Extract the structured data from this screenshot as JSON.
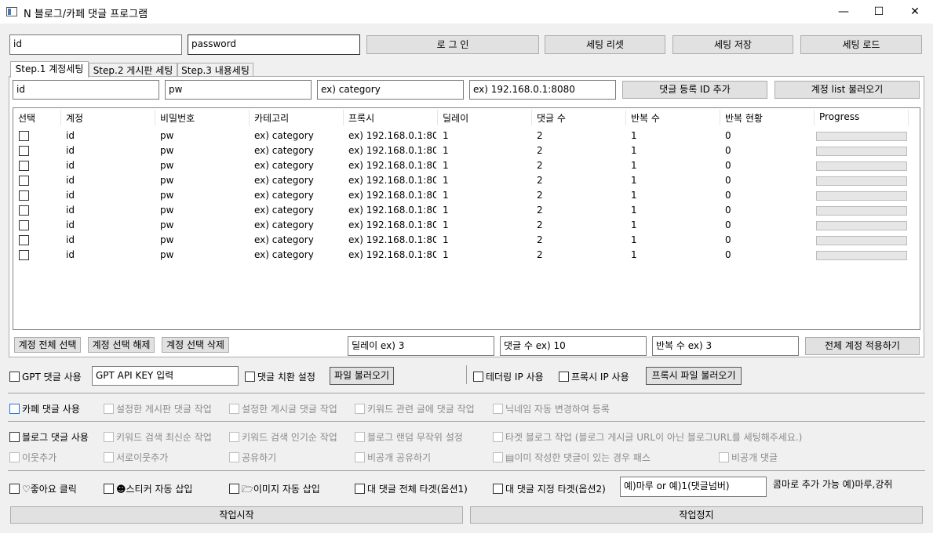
{
  "window": {
    "title": "N 블로그/카페 댓글 프로그램",
    "min": "—",
    "max": "☐",
    "close": "✕"
  },
  "login": {
    "id_value": "id",
    "password_value": "password",
    "login_label": "로 그 인",
    "reset_label": "세팅 리셋",
    "save_label": "세팅 저장",
    "load_label": "세팅 로드"
  },
  "tabs": [
    {
      "label": "Step.1 계정세팅"
    },
    {
      "label": "Step.2 게시판 세팅"
    },
    {
      "label": "Step.3 내용세팅"
    }
  ],
  "account_form": {
    "id": "id",
    "pw": "pw",
    "category": "ex) category",
    "proxy": "ex) 192.168.0.1:8080",
    "add_label": "댓글 등록 ID 추가",
    "load_list_label": "계정 list 불러오기"
  },
  "table": {
    "columns": [
      "선택",
      "계정",
      "비밀번호",
      "카테고리",
      "프록시",
      "딜레이",
      "댓글 수",
      "반복 수",
      "반복 현황",
      "Progress"
    ],
    "rows": [
      {
        "account": "id",
        "password": "pw",
        "category": "ex) category",
        "proxy": "ex) 192.168.0.1:80...",
        "delay": "1",
        "comments": "2",
        "repeat": "1",
        "status": "0",
        "progress": 0
      },
      {
        "account": "id",
        "password": "pw",
        "category": "ex) category",
        "proxy": "ex) 192.168.0.1:80...",
        "delay": "1",
        "comments": "2",
        "repeat": "1",
        "status": "0",
        "progress": 0
      },
      {
        "account": "id",
        "password": "pw",
        "category": "ex) category",
        "proxy": "ex) 192.168.0.1:80...",
        "delay": "1",
        "comments": "2",
        "repeat": "1",
        "status": "0",
        "progress": 0
      },
      {
        "account": "id",
        "password": "pw",
        "category": "ex) category",
        "proxy": "ex) 192.168.0.1:80...",
        "delay": "1",
        "comments": "2",
        "repeat": "1",
        "status": "0",
        "progress": 0
      },
      {
        "account": "id",
        "password": "pw",
        "category": "ex) category",
        "proxy": "ex) 192.168.0.1:80...",
        "delay": "1",
        "comments": "2",
        "repeat": "1",
        "status": "0",
        "progress": 0
      },
      {
        "account": "id",
        "password": "pw",
        "category": "ex) category",
        "proxy": "ex) 192.168.0.1:80...",
        "delay": "1",
        "comments": "2",
        "repeat": "1",
        "status": "0",
        "progress": 0
      },
      {
        "account": "id",
        "password": "pw",
        "category": "ex) category",
        "proxy": "ex) 192.168.0.1:80...",
        "delay": "1",
        "comments": "2",
        "repeat": "1",
        "status": "0",
        "progress": 0
      },
      {
        "account": "id",
        "password": "pw",
        "category": "ex) category",
        "proxy": "ex) 192.168.0.1:80...",
        "delay": "1",
        "comments": "2",
        "repeat": "1",
        "status": "0",
        "progress": 0
      },
      {
        "account": "id",
        "password": "pw",
        "category": "ex) category",
        "proxy": "ex) 192.168.0.1:80...",
        "delay": "1",
        "comments": "2",
        "repeat": "1",
        "status": "0",
        "progress": 0
      }
    ]
  },
  "account_actions": {
    "select_all": "계정 전체 선택",
    "deselect": "계정 선택 해제",
    "delete": "계정 선택 삭제",
    "delay": "딜레이 ex) 3",
    "comment_count": "댓글 수 ex) 10",
    "repeat_count": "반복 수 ex) 3",
    "apply_all": "전체 계정 적용하기"
  },
  "gpt": {
    "use_label": "GPT 댓글 사용",
    "api_key": "GPT API KEY 입력",
    "replace_label": "댓글 치환 설정",
    "file_load": "파일 불러오기"
  },
  "ip": {
    "tethering": "테더링 IP 사용",
    "proxy": "프록시 IP 사용",
    "proxy_file": "프록시 파일 불러오기"
  },
  "cafe": {
    "use": "카페 댓글 사용",
    "board": "설정한 게시판 댓글 작업",
    "post": "설정한 게시글 댓글 작업",
    "keyword": "키워드 관련 글에 댓글 작업",
    "nickname": "닉네임 자동 변경하여 등록"
  },
  "blog": {
    "use": "블로그 댓글 사용",
    "latest": "키워드 검색 최신순 작업",
    "popular": "키워드 검색 인기순 작업",
    "random": "블로그 랜덤 무작위 설정",
    "target": "타겟 블로그 작업 (블로그 게시글 URL이 아닌 블로그URL를 세팅해주세요.)",
    "neighbor": "이웃추가",
    "mutual": "서로이웃추가",
    "share": "공유하기",
    "private_share": "비공개 공유하기",
    "skip": "▤이미 작성한 댓글이 있는 경우 패스",
    "private_comment": "비공개 댓글"
  },
  "options": {
    "like": "♡좋아요 클릭",
    "sticker": "☻스티커 자동 삽입",
    "image": "🗁이미지 자동 삽입",
    "all_target": "대 댓글 전체 타겟(옵션1)",
    "specific_target": "대 댓글 지정 타겟(옵션2)",
    "target_input": "예)마루 or 예)1(댓글넘버)",
    "hint": "콤마로 추가 가능 예)마루,강쥐"
  },
  "run": {
    "start": "작업시작",
    "stop": "작업정지"
  }
}
